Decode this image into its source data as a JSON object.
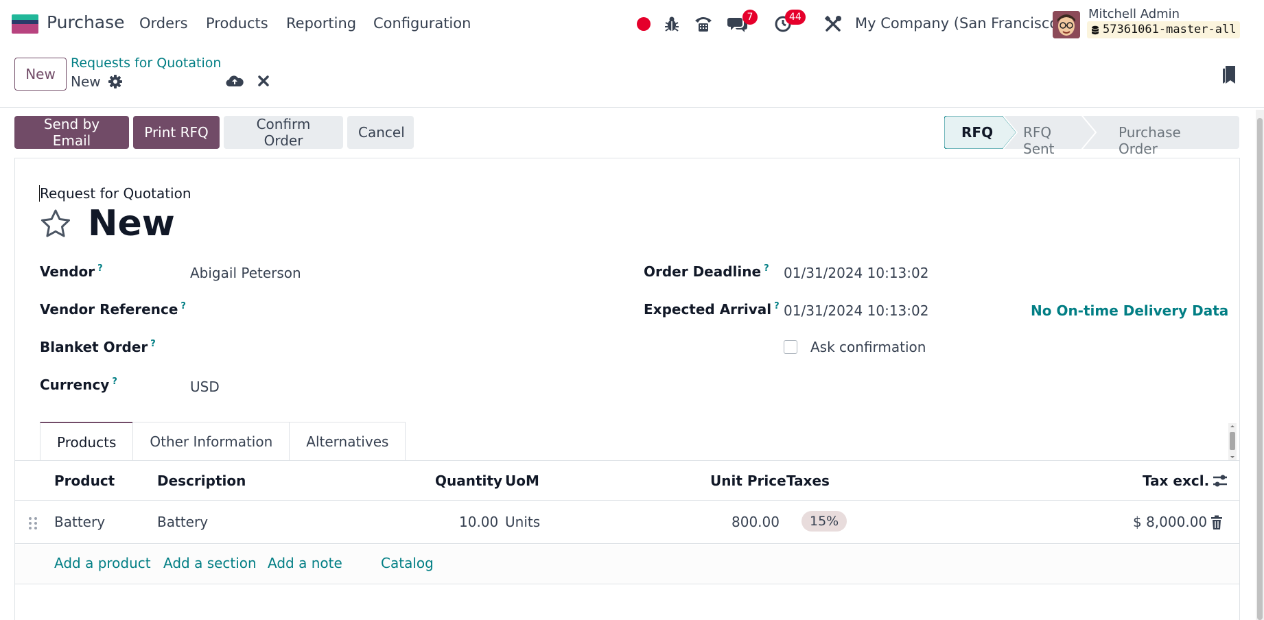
{
  "navbar": {
    "app_name": "Purchase",
    "menu": [
      "Orders",
      "Products",
      "Reporting",
      "Configuration"
    ],
    "chat_badge": "7",
    "activity_badge": "44",
    "company": "My Company (San Francisco)",
    "user_name": "Mitchell Admin",
    "database": "57361061-master-all",
    "colors": {
      "recording": "#e5002b",
      "badge": "#e5002b"
    }
  },
  "control_panel": {
    "new_label": "New",
    "breadcrumb": "Requests for Quotation",
    "record_name": "New"
  },
  "actions": {
    "send_email": "Send by Email",
    "print_rfq": "Print RFQ",
    "confirm_order": "Confirm Order",
    "cancel": "Cancel"
  },
  "stages": [
    {
      "label": "RFQ",
      "active": true
    },
    {
      "label": "RFQ Sent",
      "active": false
    },
    {
      "label": "Purchase Order",
      "active": false
    }
  ],
  "form": {
    "type_label": "Request for Quotation",
    "title": "New",
    "left_fields": {
      "vendor": {
        "label": "Vendor",
        "help": "?",
        "value": "Abigail Peterson"
      },
      "vendor_reference": {
        "label": "Vendor Reference",
        "help": "?",
        "value": ""
      },
      "blanket_order": {
        "label": "Blanket Order",
        "help": "?",
        "value": ""
      },
      "currency": {
        "label": "Currency",
        "help": "?",
        "value": "USD"
      }
    },
    "right_fields": {
      "order_deadline": {
        "label": "Order Deadline",
        "help": "?",
        "value": "01/31/2024 10:13:02"
      },
      "expected_arrival": {
        "label": "Expected Arrival",
        "help": "?",
        "value": "01/31/2024 10:13:02"
      },
      "on_time_delivery": "No On-time Delivery Data",
      "ask_confirmation": {
        "label": "Ask confirmation",
        "checked": false
      }
    }
  },
  "tabs": [
    {
      "label": "Products",
      "active": true
    },
    {
      "label": "Other Information",
      "active": false
    },
    {
      "label": "Alternatives",
      "active": false
    }
  ],
  "table": {
    "headers": {
      "product": "Product",
      "description": "Description",
      "quantity": "Quantity",
      "uom": "UoM",
      "unit_price": "Unit Price",
      "taxes": "Taxes",
      "tax_excl": "Tax excl."
    },
    "rows": [
      {
        "product": "Battery",
        "description": "Battery",
        "quantity": "10.00",
        "uom": "Units",
        "unit_price": "800.00",
        "taxes": "15%",
        "tax_excl": "$ 8,000.00"
      }
    ],
    "add_links": {
      "add_product": "Add a product",
      "add_section": "Add a section",
      "add_note": "Add a note",
      "catalog": "Catalog"
    }
  }
}
